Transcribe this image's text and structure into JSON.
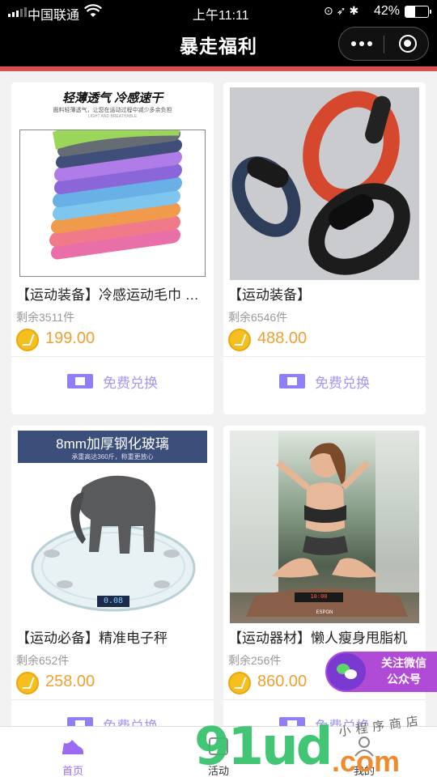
{
  "status_bar": {
    "carrier": "中国联通",
    "time": "上午11:11",
    "battery": "42%",
    "battery_level": 0.42
  },
  "nav": {
    "title": "暴走福利"
  },
  "products": [
    {
      "name": "【运动装备】冷感运动毛巾 …",
      "stock": "剩余3511件",
      "price": "199.00",
      "exchange": "免费兑换",
      "banner_title": "轻薄透气 冷感速干",
      "banner_sub": "面料轻薄透气，让您在运动过程中减少多余负担",
      "banner_small": "LIGHT AND BREATHABLE"
    },
    {
      "name": "【运动装备】",
      "stock": "剩余6546件",
      "price": "488.00",
      "exchange": "免费兑换"
    },
    {
      "name": "【运动必备】精准电子秤",
      "stock": "剩余652件",
      "price": "258.00",
      "exchange": "免费兑换",
      "banner_title": "8mm加厚钢化玻璃",
      "banner_sub": "承重高达360斤，称重更放心",
      "scale_reading": "0.08"
    },
    {
      "name": "【运动器材】懒人瘦身甩脂机",
      "stock": "剩余256件",
      "price": "860.00",
      "exchange": "免费兑换",
      "device_brand": "ESPON",
      "device_display": "10:00"
    }
  ],
  "float_button": {
    "line1": "关注微信",
    "line2": "公众号"
  },
  "tabs": [
    {
      "label": "首页"
    },
    {
      "label": "活动"
    },
    {
      "label": "我的"
    }
  ],
  "watermark": {
    "logo": "91ud",
    "domain": ".com",
    "tagline": "小程序商店"
  },
  "colors": {
    "accent": "#d9504f",
    "price": "#f0a030",
    "exchange": "#a497f7",
    "tab_active": "#9b6cf0"
  }
}
